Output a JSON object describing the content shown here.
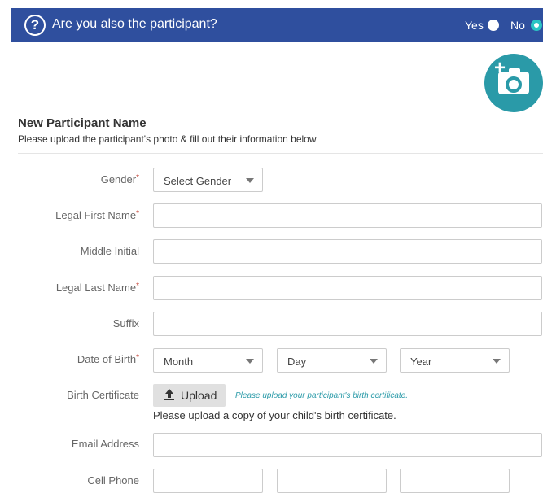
{
  "header": {
    "question": "Are you also the participant?",
    "yes_label": "Yes",
    "no_label": "No",
    "selected": "No",
    "accent": "#2bc4c4",
    "bg": "#2f4f9e"
  },
  "photo_button": {
    "icon": "add-photo-camera-icon",
    "plus": "+"
  },
  "section": {
    "title": "New Participant Name",
    "subtitle": "Please upload the participant's photo & fill out their information below"
  },
  "form": {
    "gender": {
      "label": "Gender",
      "required": "*",
      "value": "Select Gender"
    },
    "first_name": {
      "label": "Legal First Name",
      "required": "*",
      "value": ""
    },
    "middle_initial": {
      "label": "Middle Initial",
      "value": ""
    },
    "last_name": {
      "label": "Legal Last Name",
      "required": "*",
      "value": ""
    },
    "suffix": {
      "label": "Suffix",
      "value": ""
    },
    "dob": {
      "label": "Date of Birth",
      "required": "*",
      "month": "Month",
      "day": "Day",
      "year": "Year"
    },
    "birth_certificate": {
      "label": "Birth Certificate",
      "button": "Upload",
      "hint": "Please upload your participant's birth certificate.",
      "note": "Please upload a copy of your child's birth certificate."
    },
    "email": {
      "label": "Email Address",
      "value": ""
    },
    "cell_phone": {
      "label": "Cell Phone"
    }
  }
}
